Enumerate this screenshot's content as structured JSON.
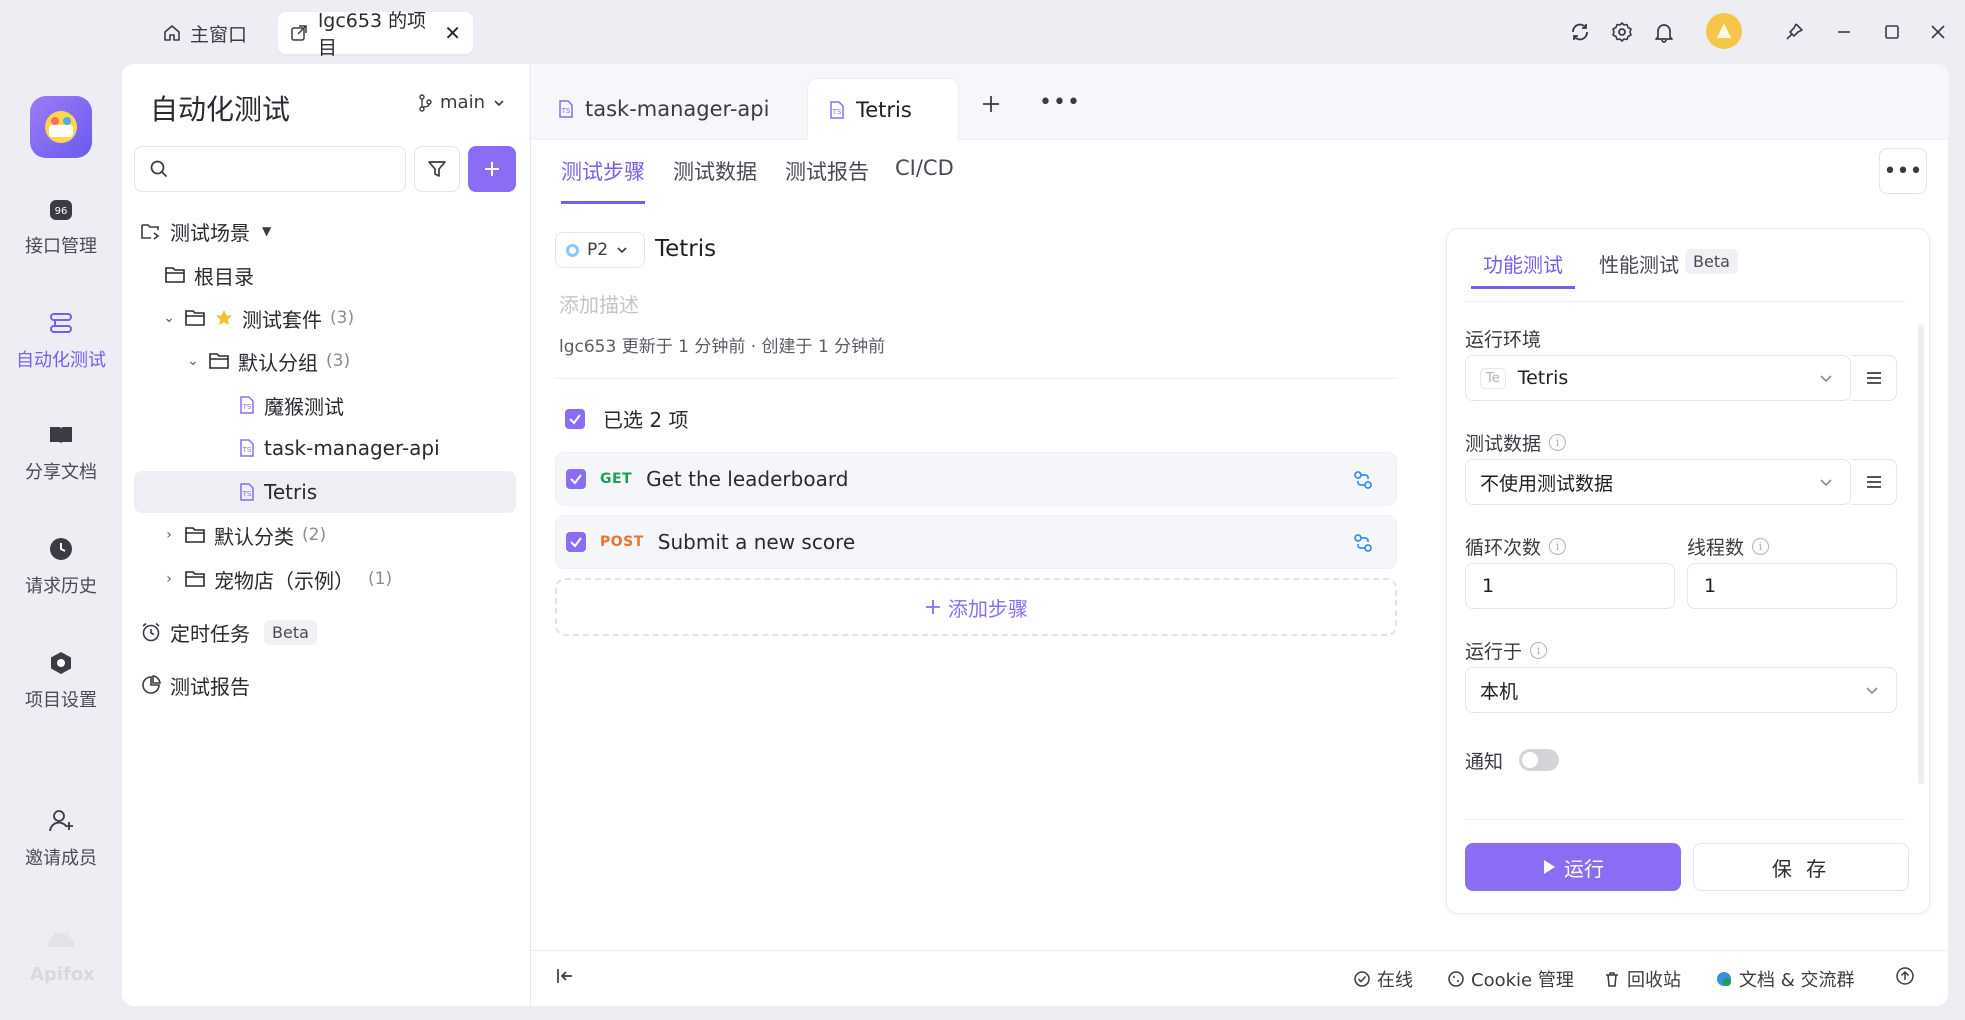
{
  "titlebar": {
    "home_tab": "主窗口",
    "project_tab": "lgc653 的项目"
  },
  "rail": {
    "items": [
      {
        "label": "接口管理",
        "icon": "api-icon"
      },
      {
        "label": "自动化测试",
        "icon": "automation-icon",
        "active": true
      },
      {
        "label": "分享文档",
        "icon": "book-icon"
      },
      {
        "label": "请求历史",
        "icon": "clock-icon"
      },
      {
        "label": "项目设置",
        "icon": "settings-icon"
      },
      {
        "label": "邀请成员",
        "icon": "add-user-icon"
      }
    ],
    "brand": "Apifox"
  },
  "tree": {
    "title": "自动化测试",
    "branch": "main",
    "search_placeholder": "",
    "section": "测试场景",
    "root": "根目录",
    "suite": {
      "label": "测试套件",
      "count": "(3)"
    },
    "group": {
      "label": "默认分组",
      "count": "(3)"
    },
    "cases": [
      "魔猴测试",
      "task-manager-api",
      "Tetris"
    ],
    "default_cat": {
      "label": "默认分类",
      "count": "(2)"
    },
    "petstore": {
      "label": "宠物店（示例）",
      "count": "(1)"
    },
    "scheduled": "定时任务",
    "scheduled_badge": "Beta",
    "reports": "测试报告"
  },
  "doc_tabs": [
    "task-manager-api",
    "Tetris"
  ],
  "sub_tabs": [
    "测试步骤",
    "测试数据",
    "测试报告",
    "CI/CD"
  ],
  "scenario": {
    "priority": "P2",
    "name": "Tetris",
    "desc_placeholder": "添加描述",
    "meta": "lgc653 更新于 1 分钟前 · 创建于 1 分钟前",
    "selected": "已选 2 项",
    "steps": [
      {
        "method": "GET",
        "name": "Get the leaderboard",
        "color": "#18a058"
      },
      {
        "method": "POST",
        "name": "Submit a new score",
        "color": "#f0722c"
      }
    ],
    "add_step": "添加步骤"
  },
  "run": {
    "tabs": [
      "功能测试",
      "性能测试"
    ],
    "perf_badge": "Beta",
    "env_label": "运行环境",
    "env_badge": "Te",
    "env_value": "Tetris",
    "data_label": "测试数据",
    "data_value": "不使用测试数据",
    "loop_label": "循环次数",
    "loop_value": "1",
    "thread_label": "线程数",
    "thread_value": "1",
    "runon_label": "运行于",
    "runon_value": "本机",
    "notify_label": "通知",
    "run_btn": "运行",
    "save_btn": "保 存"
  },
  "statusbar": {
    "online": "在线",
    "cookie": "Cookie 管理",
    "trash": "回收站",
    "docs": "文档 & 交流群"
  },
  "colors": {
    "accent": "#8b6cf4",
    "get": "#18a058",
    "post": "#f0722c"
  }
}
